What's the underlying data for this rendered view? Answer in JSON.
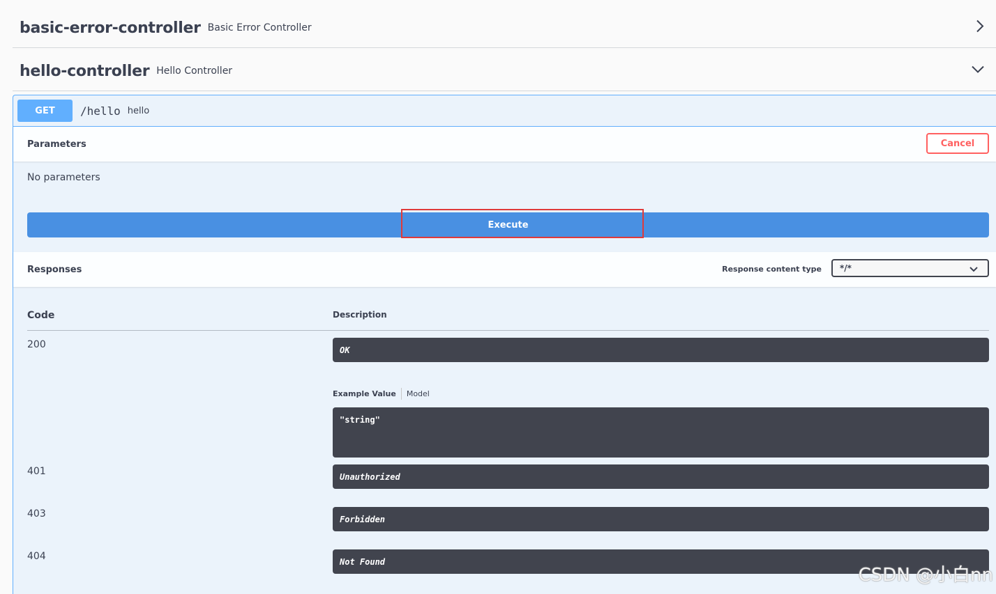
{
  "tags": [
    {
      "name": "basic-error-controller",
      "description": "Basic Error Controller"
    },
    {
      "name": "hello-controller",
      "description": "Hello Controller"
    }
  ],
  "operation": {
    "method": "GET",
    "path": "/hello",
    "summary": "hello"
  },
  "parameters": {
    "title": "Parameters",
    "cancel_label": "Cancel",
    "empty_text": "No parameters",
    "execute_label": "Execute"
  },
  "responses": {
    "title": "Responses",
    "content_type_label": "Response content type",
    "content_type_value": "*/*",
    "code_header": "Code",
    "description_header": "Description",
    "example_tab": "Example Value",
    "model_tab": "Model",
    "items": [
      {
        "code": "200",
        "message": "OK",
        "example": "\"string\""
      },
      {
        "code": "401",
        "message": "Unauthorized"
      },
      {
        "code": "403",
        "message": "Forbidden"
      },
      {
        "code": "404",
        "message": "Not Found"
      }
    ]
  },
  "watermark": "CSDN @小白nn",
  "colors": {
    "get": "#61affe",
    "execute": "#4990e2",
    "cancel": "#ff6060",
    "dark_box": "#41444e",
    "highlight": "#e03a3a"
  }
}
